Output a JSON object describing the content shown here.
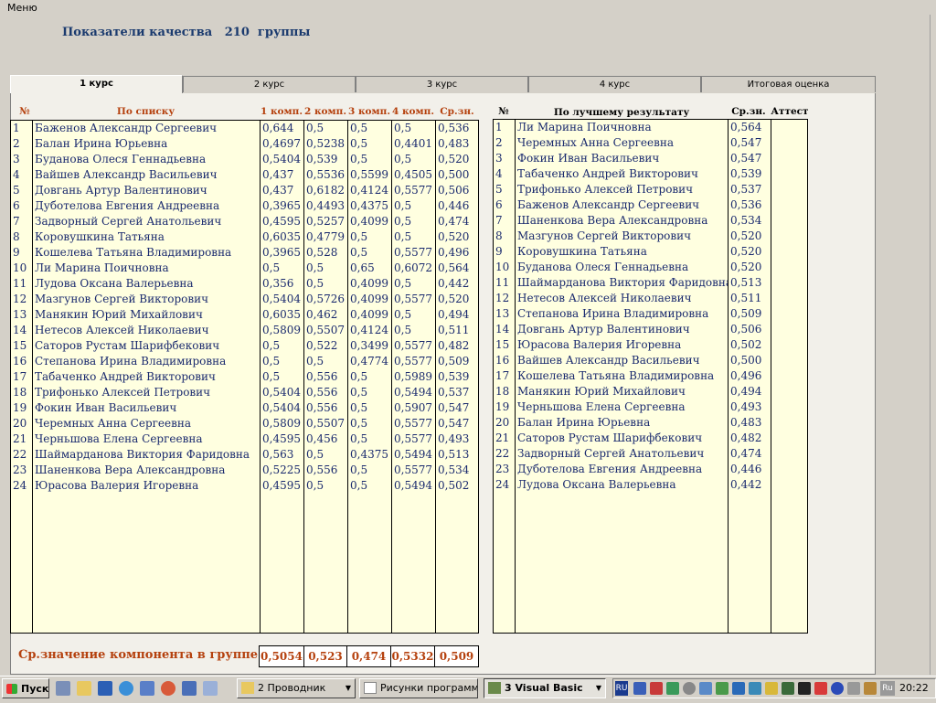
{
  "menu": {
    "label": "Меню"
  },
  "title": "Показатели качества   210  группы",
  "tabs": [
    "1 курс",
    "2 курс",
    "3 курс",
    "4 курс",
    "Итоговая оценка"
  ],
  "left_table": {
    "headers": {
      "num": "№",
      "name": "По списку",
      "k1": "1 комп.",
      "k2": "2 комп.",
      "k3": "3 комп.",
      "k4": "4 комп.",
      "avg": "Ср.зн."
    },
    "rows": [
      [
        "1",
        "Баженов Александр Сергеевич",
        "0,644",
        "0,5",
        "0,5",
        "0,5",
        "0,536"
      ],
      [
        "2",
        "Балан Ирина Юрьевна",
        "0,4697",
        "0,5238",
        "0,5",
        "0,4401",
        "0,483"
      ],
      [
        "3",
        "Буданова Олеся Геннадьевна",
        "0,5404",
        "0,539",
        "0,5",
        "0,5",
        "0,520"
      ],
      [
        "4",
        "Вайшев Александр Васильевич",
        "0,437",
        "0,5536",
        "0,5599",
        "0,4505",
        "0,500"
      ],
      [
        "5",
        "Довгань Артур Валентинович",
        "0,437",
        "0,6182",
        "0,4124",
        "0,5577",
        "0,506"
      ],
      [
        "6",
        "Дуботелова Евгения Андреевна",
        "0,3965",
        "0,4493",
        "0,4375",
        "0,5",
        "0,446"
      ],
      [
        "7",
        "Задворный Сергей Анатольевич",
        "0,4595",
        "0,5257",
        "0,4099",
        "0,5",
        "0,474"
      ],
      [
        "8",
        "Коровушкина Татьяна",
        "0,6035",
        "0,4779",
        "0,5",
        "0,5",
        "0,520"
      ],
      [
        "9",
        "Кошелева Татьяна Владимировна",
        "0,3965",
        "0,528",
        "0,5",
        "0,5577",
        "0,496"
      ],
      [
        "10",
        "Ли Марина Поичновна",
        "0,5",
        "0,5",
        "0,65",
        "0,6072",
        "0,564"
      ],
      [
        "11",
        "Лудова Оксана Валерьевна",
        "0,356",
        "0,5",
        "0,4099",
        "0,5",
        "0,442"
      ],
      [
        "12",
        "Мазгунов Сергей Викторович",
        "0,5404",
        "0,5726",
        "0,4099",
        "0,5577",
        "0,520"
      ],
      [
        "13",
        "Манякин Юрий Михайлович",
        "0,6035",
        "0,462",
        "0,4099",
        "0,5",
        "0,494"
      ],
      [
        "14",
        "Нетесов Алексей Николаевич",
        "0,5809",
        "0,5507",
        "0,4124",
        "0,5",
        "0,511"
      ],
      [
        "15",
        "Саторов Рустам Шарифбекович",
        "0,5",
        "0,522",
        "0,3499",
        "0,5577",
        "0,482"
      ],
      [
        "16",
        "Степанова Ирина Владимировна",
        "0,5",
        "0,5",
        "0,4774",
        "0,5577",
        "0,509"
      ],
      [
        "17",
        "Табаченко Андрей Викторович",
        "0,5",
        "0,556",
        "0,5",
        "0,5989",
        "0,539"
      ],
      [
        "18",
        "Трифонько Алексей Петрович",
        "0,5404",
        "0,556",
        "0,5",
        "0,5494",
        "0,537"
      ],
      [
        "19",
        "Фокин Иван Васильевич",
        "0,5404",
        "0,556",
        "0,5",
        "0,5907",
        "0,547"
      ],
      [
        "20",
        "Черемных Анна Сергеевна",
        "0,5809",
        "0,5507",
        "0,5",
        "0,5577",
        "0,547"
      ],
      [
        "21",
        "Черньшова Елена Сергеевна",
        "0,4595",
        "0,456",
        "0,5",
        "0,5577",
        "0,493"
      ],
      [
        "22",
        "Шаймарданова Виктория Фаридовна",
        "0,563",
        "0,5",
        "0,4375",
        "0,5494",
        "0,513"
      ],
      [
        "23",
        "Шаненкова Вера Александровна",
        "0,5225",
        "0,556",
        "0,5",
        "0,5577",
        "0,534"
      ],
      [
        "24",
        "Юрасова Валерия Игоревна",
        "0,4595",
        "0,5",
        "0,5",
        "0,5494",
        "0,502"
      ]
    ]
  },
  "right_table": {
    "headers": {
      "num": "№",
      "name": "По лучшему результату",
      "avg": "Ср.зн.",
      "att": "Аттест"
    },
    "rows": [
      [
        "1",
        "Ли Марина Поичновна",
        "0,564"
      ],
      [
        "2",
        "Черемных Анна Сергеевна",
        "0,547"
      ],
      [
        "3",
        "Фокин Иван Васильевич",
        "0,547"
      ],
      [
        "4",
        "Табаченко Андрей Викторович",
        "0,539"
      ],
      [
        "5",
        "Трифонько Алексей Петрович",
        "0,537"
      ],
      [
        "6",
        "Баженов Александр Сергеевич",
        "0,536"
      ],
      [
        "7",
        "Шаненкова Вера Александровна",
        "0,534"
      ],
      [
        "8",
        "Мазгунов Сергей Викторович",
        "0,520"
      ],
      [
        "9",
        "Коровушкина Татьяна",
        "0,520"
      ],
      [
        "10",
        "Буданова Олеся Геннадьевна",
        "0,520"
      ],
      [
        "11",
        "Шаймарданова Виктория Фаридовна",
        "0,513"
      ],
      [
        "12",
        "Нетесов Алексей Николаевич",
        "0,511"
      ],
      [
        "13",
        "Степанова Ирина Владимировна",
        "0,509"
      ],
      [
        "14",
        "Довгань Артур Валентинович",
        "0,506"
      ],
      [
        "15",
        "Юрасова Валерия Игоревна",
        "0,502"
      ],
      [
        "16",
        "Вайшев Александр Васильевич",
        "0,500"
      ],
      [
        "17",
        "Кошелева Татьяна Владимировна",
        "0,496"
      ],
      [
        "18",
        "Манякин Юрий Михайлович",
        "0,494"
      ],
      [
        "19",
        "Черньшова Елена Сергеевна",
        "0,493"
      ],
      [
        "20",
        "Балан Ирина Юрьевна",
        "0,483"
      ],
      [
        "21",
        "Саторов Рустам Шарифбекович",
        "0,482"
      ],
      [
        "22",
        "Задворный Сергей Анатольевич",
        "0,474"
      ],
      [
        "23",
        "Дуботелова Евгения Андреевна",
        "0,446"
      ],
      [
        "24",
        "Лудова Оксана Валерьевна",
        "0,442"
      ]
    ]
  },
  "group_average": {
    "label": "Ср.значение компонента  в группе",
    "values": [
      "0,5054",
      "0,523",
      "0,474",
      "0,5332",
      "0,509"
    ]
  },
  "taskbar": {
    "start": "Пуск",
    "buttons": [
      "2 Проводник",
      "Рисунки программ...",
      "3 Visual Basic"
    ],
    "lang": "RU",
    "lang2": "Ru",
    "clock": "20:22"
  },
  "colors": {
    "header": "#b5410e",
    "cell_text": "#1a2a6e",
    "cell_bg": "#ffffe0",
    "title": "#1a3a6e"
  }
}
